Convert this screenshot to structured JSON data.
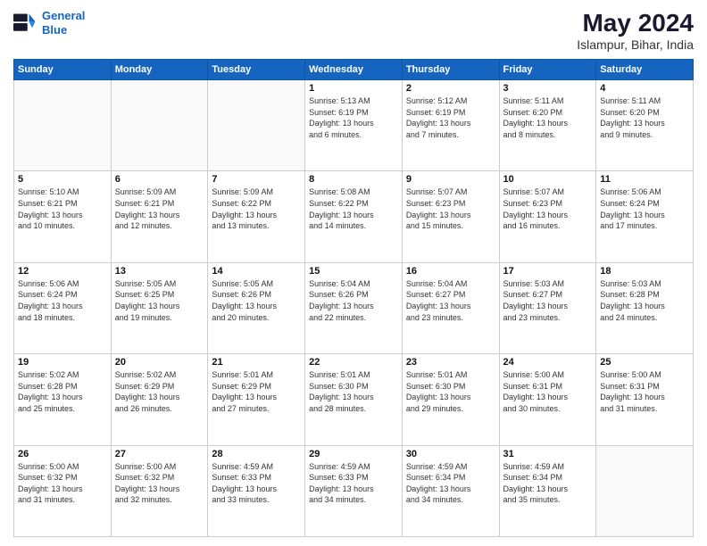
{
  "header": {
    "logo_line1": "General",
    "logo_line2": "Blue",
    "main_title": "May 2024",
    "subtitle": "Islampur, Bihar, India"
  },
  "weekdays": [
    "Sunday",
    "Monday",
    "Tuesday",
    "Wednesday",
    "Thursday",
    "Friday",
    "Saturday"
  ],
  "weeks": [
    [
      {
        "day": "",
        "info": ""
      },
      {
        "day": "",
        "info": ""
      },
      {
        "day": "",
        "info": ""
      },
      {
        "day": "1",
        "info": "Sunrise: 5:13 AM\nSunset: 6:19 PM\nDaylight: 13 hours\nand 6 minutes."
      },
      {
        "day": "2",
        "info": "Sunrise: 5:12 AM\nSunset: 6:19 PM\nDaylight: 13 hours\nand 7 minutes."
      },
      {
        "day": "3",
        "info": "Sunrise: 5:11 AM\nSunset: 6:20 PM\nDaylight: 13 hours\nand 8 minutes."
      },
      {
        "day": "4",
        "info": "Sunrise: 5:11 AM\nSunset: 6:20 PM\nDaylight: 13 hours\nand 9 minutes."
      }
    ],
    [
      {
        "day": "5",
        "info": "Sunrise: 5:10 AM\nSunset: 6:21 PM\nDaylight: 13 hours\nand 10 minutes."
      },
      {
        "day": "6",
        "info": "Sunrise: 5:09 AM\nSunset: 6:21 PM\nDaylight: 13 hours\nand 12 minutes."
      },
      {
        "day": "7",
        "info": "Sunrise: 5:09 AM\nSunset: 6:22 PM\nDaylight: 13 hours\nand 13 minutes."
      },
      {
        "day": "8",
        "info": "Sunrise: 5:08 AM\nSunset: 6:22 PM\nDaylight: 13 hours\nand 14 minutes."
      },
      {
        "day": "9",
        "info": "Sunrise: 5:07 AM\nSunset: 6:23 PM\nDaylight: 13 hours\nand 15 minutes."
      },
      {
        "day": "10",
        "info": "Sunrise: 5:07 AM\nSunset: 6:23 PM\nDaylight: 13 hours\nand 16 minutes."
      },
      {
        "day": "11",
        "info": "Sunrise: 5:06 AM\nSunset: 6:24 PM\nDaylight: 13 hours\nand 17 minutes."
      }
    ],
    [
      {
        "day": "12",
        "info": "Sunrise: 5:06 AM\nSunset: 6:24 PM\nDaylight: 13 hours\nand 18 minutes."
      },
      {
        "day": "13",
        "info": "Sunrise: 5:05 AM\nSunset: 6:25 PM\nDaylight: 13 hours\nand 19 minutes."
      },
      {
        "day": "14",
        "info": "Sunrise: 5:05 AM\nSunset: 6:26 PM\nDaylight: 13 hours\nand 20 minutes."
      },
      {
        "day": "15",
        "info": "Sunrise: 5:04 AM\nSunset: 6:26 PM\nDaylight: 13 hours\nand 22 minutes."
      },
      {
        "day": "16",
        "info": "Sunrise: 5:04 AM\nSunset: 6:27 PM\nDaylight: 13 hours\nand 23 minutes."
      },
      {
        "day": "17",
        "info": "Sunrise: 5:03 AM\nSunset: 6:27 PM\nDaylight: 13 hours\nand 23 minutes."
      },
      {
        "day": "18",
        "info": "Sunrise: 5:03 AM\nSunset: 6:28 PM\nDaylight: 13 hours\nand 24 minutes."
      }
    ],
    [
      {
        "day": "19",
        "info": "Sunrise: 5:02 AM\nSunset: 6:28 PM\nDaylight: 13 hours\nand 25 minutes."
      },
      {
        "day": "20",
        "info": "Sunrise: 5:02 AM\nSunset: 6:29 PM\nDaylight: 13 hours\nand 26 minutes."
      },
      {
        "day": "21",
        "info": "Sunrise: 5:01 AM\nSunset: 6:29 PM\nDaylight: 13 hours\nand 27 minutes."
      },
      {
        "day": "22",
        "info": "Sunrise: 5:01 AM\nSunset: 6:30 PM\nDaylight: 13 hours\nand 28 minutes."
      },
      {
        "day": "23",
        "info": "Sunrise: 5:01 AM\nSunset: 6:30 PM\nDaylight: 13 hours\nand 29 minutes."
      },
      {
        "day": "24",
        "info": "Sunrise: 5:00 AM\nSunset: 6:31 PM\nDaylight: 13 hours\nand 30 minutes."
      },
      {
        "day": "25",
        "info": "Sunrise: 5:00 AM\nSunset: 6:31 PM\nDaylight: 13 hours\nand 31 minutes."
      }
    ],
    [
      {
        "day": "26",
        "info": "Sunrise: 5:00 AM\nSunset: 6:32 PM\nDaylight: 13 hours\nand 31 minutes."
      },
      {
        "day": "27",
        "info": "Sunrise: 5:00 AM\nSunset: 6:32 PM\nDaylight: 13 hours\nand 32 minutes."
      },
      {
        "day": "28",
        "info": "Sunrise: 4:59 AM\nSunset: 6:33 PM\nDaylight: 13 hours\nand 33 minutes."
      },
      {
        "day": "29",
        "info": "Sunrise: 4:59 AM\nSunset: 6:33 PM\nDaylight: 13 hours\nand 34 minutes."
      },
      {
        "day": "30",
        "info": "Sunrise: 4:59 AM\nSunset: 6:34 PM\nDaylight: 13 hours\nand 34 minutes."
      },
      {
        "day": "31",
        "info": "Sunrise: 4:59 AM\nSunset: 6:34 PM\nDaylight: 13 hours\nand 35 minutes."
      },
      {
        "day": "",
        "info": ""
      }
    ]
  ]
}
